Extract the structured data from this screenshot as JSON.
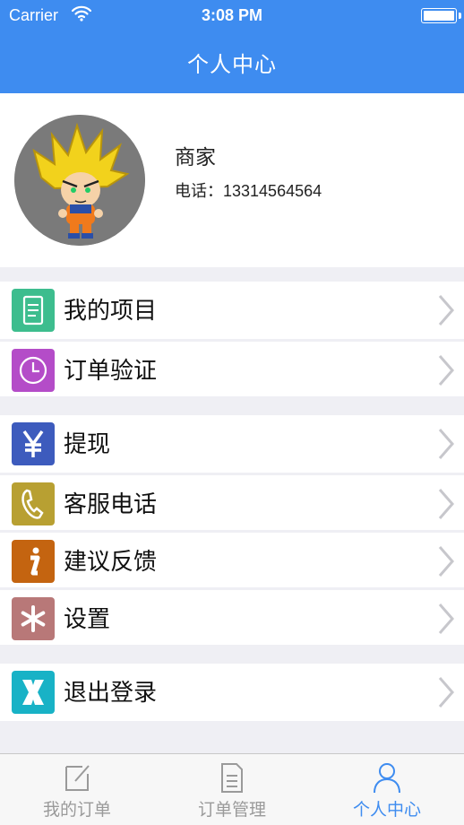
{
  "status_bar": {
    "carrier": "Carrier",
    "time": "3:08 PM"
  },
  "nav": {
    "title": "个人中心"
  },
  "profile": {
    "name": "商家",
    "phone": "电话：13314564564"
  },
  "groups": [
    {
      "items": [
        {
          "label": "我的项目",
          "icon": "document-icon",
          "color": "#3dbd8e"
        },
        {
          "label": "订单验证",
          "icon": "clock-icon",
          "color": "#b44cc8"
        }
      ]
    },
    {
      "items": [
        {
          "label": "提现",
          "icon": "yen-icon",
          "color": "#3d5bbd"
        },
        {
          "label": "客服电话",
          "icon": "phone-icon",
          "color": "#b8a032"
        },
        {
          "label": "建议反馈",
          "icon": "info-icon",
          "color": "#c46410"
        },
        {
          "label": "设置",
          "icon": "asterisk-icon",
          "color": "#b87878"
        }
      ]
    },
    {
      "items": [
        {
          "label": "退出登录",
          "icon": "logout-x-icon",
          "color": "#18b2c6"
        }
      ]
    }
  ],
  "tabbar": {
    "tabs": [
      {
        "label": "我的订单",
        "icon": "edit-icon",
        "active": false
      },
      {
        "label": "订单管理",
        "icon": "list-document-icon",
        "active": false
      },
      {
        "label": "个人中心",
        "icon": "person-icon",
        "active": true
      }
    ]
  },
  "colors": {
    "accent": "#3e8cf0",
    "background": "#efeff4"
  }
}
